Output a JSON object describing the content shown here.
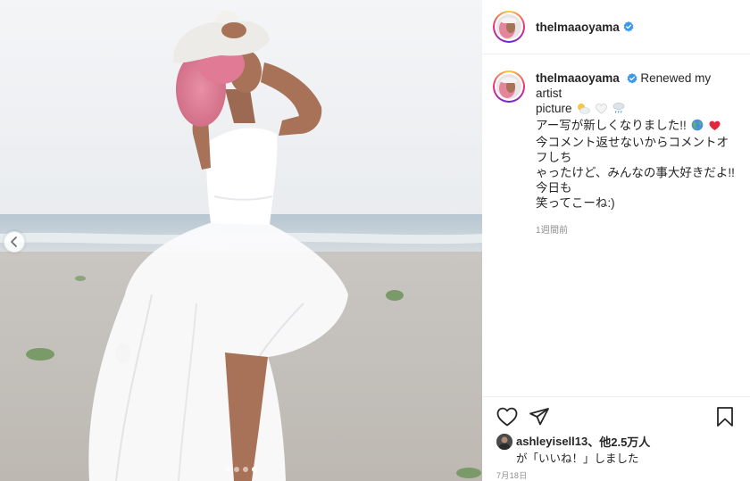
{
  "post": {
    "username": "thelmaaoyama",
    "caption_line1": "Renewed my artist",
    "caption_line2": "picture",
    "caption_line3": "アー写が新しくなりました!!",
    "caption_line4": "今コメント返せないからコメントオフしち",
    "caption_line5": "ゃったけど、みんなの事大好きだよ!!今日も",
    "caption_line6": "笑ってこーね:)",
    "time_ago": "1週間前",
    "liked_by_user": "ashleyisell13",
    "liked_by_others": "、他2.5万人",
    "liked_suffix": "が「いいね！」しました",
    "date": "7月18日",
    "carousel_total": 4,
    "carousel_active": 4
  },
  "icons": {
    "verified": "verified-badge-icon",
    "like": "heart-outline-icon",
    "share": "paper-plane-icon",
    "save": "bookmark-outline-icon",
    "prev": "chevron-left-icon",
    "emoji_cloud": "sun-behind-cloud-emoji",
    "emoji_white_heart": "white-heart-emoji",
    "emoji_rain": "cloud-with-rain-emoji",
    "emoji_globe": "globe-emoji",
    "emoji_red_heart": "red-heart-emoji"
  },
  "colors": {
    "verified_blue": "#3897f0",
    "text_primary": "#262626",
    "text_secondary": "#8e8e8e",
    "divider": "#efefef"
  }
}
